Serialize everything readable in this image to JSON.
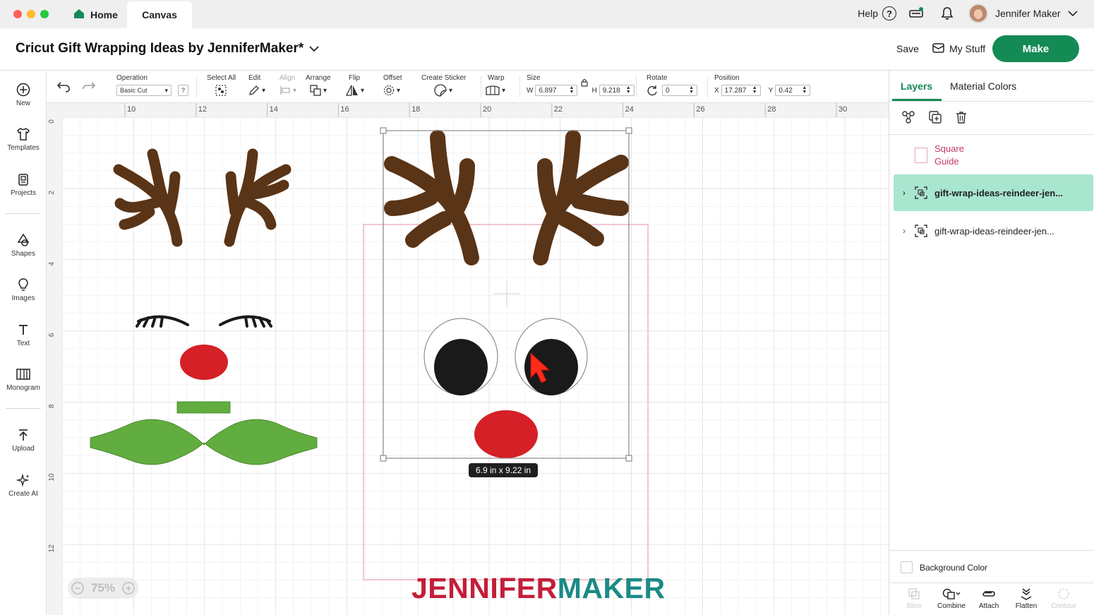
{
  "window": {
    "tabs": [
      {
        "label": "Home",
        "icon": "home-icon"
      },
      {
        "label": "Canvas"
      }
    ],
    "help_label": "Help",
    "user_name": "Jennifer Maker"
  },
  "header": {
    "project_title": "Cricut Gift Wrapping Ideas by JenniferMaker*",
    "save_label": "Save",
    "mystuff_label": "My Stuff",
    "make_label": "Make",
    "accent_color": "#148a55"
  },
  "sidebar": {
    "items": [
      {
        "label": "New",
        "icon": "plus-circle-icon"
      },
      {
        "label": "Templates",
        "icon": "shirt-icon"
      },
      {
        "label": "Projects",
        "icon": "projects-icon"
      },
      {
        "label": "Shapes",
        "icon": "shapes-icon"
      },
      {
        "label": "Images",
        "icon": "lightbulb-icon"
      },
      {
        "label": "Text",
        "icon": "text-icon"
      },
      {
        "label": "Monogram",
        "icon": "monogram-icon"
      },
      {
        "label": "Upload",
        "icon": "upload-icon"
      },
      {
        "label": "Create AI",
        "icon": "sparkle-icon"
      }
    ]
  },
  "toolbar": {
    "operation_label": "Operation",
    "operation_value": "Basic Cut",
    "help_q": "?",
    "select_all_label": "Select All",
    "edit_label": "Edit",
    "align_label": "Align",
    "arrange_label": "Arrange",
    "flip_label": "Flip",
    "offset_label": "Offset",
    "create_sticker_label": "Create Sticker",
    "warp_label": "Warp",
    "size_label": "Size",
    "w_label": "W",
    "w_value": "6.897",
    "h_label": "H",
    "h_value": "9.218",
    "rotate_label": "Rotate",
    "rotate_value": "0",
    "position_label": "Position",
    "x_label": "X",
    "x_value": "17.287",
    "y_label": "Y",
    "y_value": "0.42"
  },
  "canvas": {
    "ruler_top": [
      "10",
      "12",
      "14",
      "16",
      "18",
      "20",
      "22",
      "24",
      "26",
      "28",
      "30"
    ],
    "ruler_left": [
      "0",
      "2",
      "4",
      "6",
      "8",
      "10",
      "12"
    ],
    "selection_size_label": "6.9  in x 9.22  in",
    "zoom_label": "75%",
    "colors": {
      "antler": "#5a3416",
      "nose": "#d42026",
      "bow": "#62ad3f",
      "eye_dark": "#1a1a1a",
      "guide": "#e8a5b8"
    }
  },
  "layers_panel": {
    "tab_layers": "Layers",
    "tab_material_colors": "Material Colors",
    "guide_label_1": "Square",
    "guide_label_2": "Guide",
    "layers": [
      {
        "name": "gift-wrap-ideas-reindeer-jen...",
        "selected": true
      },
      {
        "name": "gift-wrap-ideas-reindeer-jen...",
        "selected": false
      }
    ],
    "background_color_label": "Background Color",
    "bottom_tools": [
      {
        "label": "Slice",
        "enabled": false
      },
      {
        "label": "Combine",
        "enabled": true
      },
      {
        "label": "Attach",
        "enabled": true
      },
      {
        "label": "Flatten",
        "enabled": true
      },
      {
        "label": "Contour",
        "enabled": false
      }
    ]
  },
  "watermark": {
    "part1": "JENNIFER",
    "part2": "MAKER"
  }
}
